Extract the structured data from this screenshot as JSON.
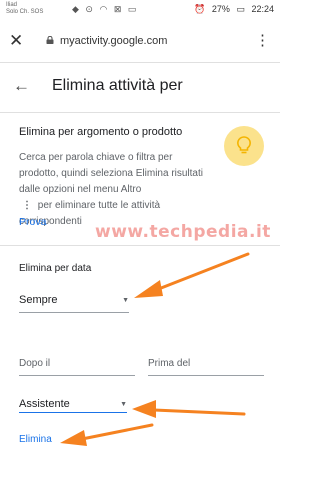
{
  "status_bar": {
    "carrier_line1": "Iliad",
    "carrier_line2": "Solo Ch. SOS",
    "icons_text": "◆ ⊙ ◠ ⊠ ▭",
    "alarm_icon": "alarm-icon",
    "battery": "27%",
    "time": "22:24"
  },
  "browser": {
    "close_icon": "close-icon",
    "lock_icon": "lock-icon",
    "url": "myactivity.google.com",
    "menu_icon": "more-vert-icon"
  },
  "header": {
    "back_icon": "arrow-back-icon",
    "title": "Elimina attività per"
  },
  "topic_section": {
    "title": "Elimina per argomento o prodotto",
    "desc_part1": "Cerca per parola chiave o filtra per prodotto, quindi seleziona Elimina risultati dalle opzioni nel menu Altro",
    "desc_dots": "⋮",
    "desc_part2": "per eliminare tutte le attività corrispondenti",
    "icon": "lightbulb-icon",
    "link": "Prova"
  },
  "watermark": "www.techpedia.it",
  "date_section": {
    "title": "Elimina per data",
    "range_select": "Sempre",
    "after_select": "Dopo il",
    "before_select": "Prima del",
    "product_select": "Assistente",
    "delete_link": "Elimina"
  },
  "colors": {
    "accent": "#1a73e8",
    "arrows": "#f58220",
    "bulb": "#fbe28c"
  }
}
